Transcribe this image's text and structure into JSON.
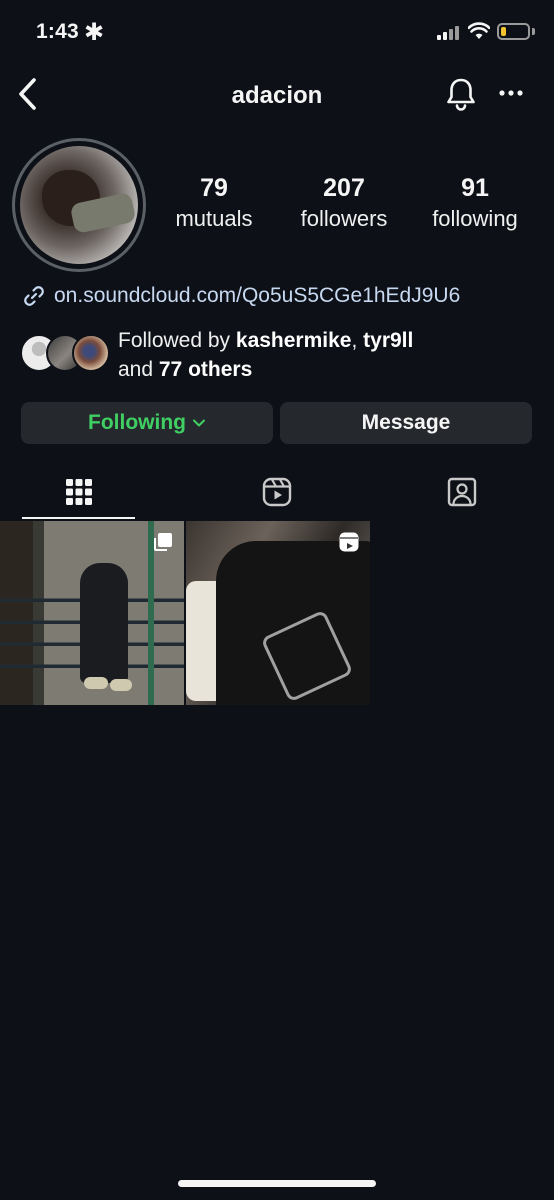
{
  "status_bar": {
    "time": "1:43",
    "asterisk": "✱",
    "battery_level": 0.2,
    "battery_color": "#f4c430"
  },
  "header": {
    "username": "adacion",
    "back_icon": "chevron-left-icon",
    "bell_icon": "bell-icon",
    "more_icon": "more-horizontal-icon"
  },
  "profile": {
    "stats": [
      {
        "value": "79",
        "label": "mutuals"
      },
      {
        "value": "207",
        "label": "followers"
      },
      {
        "value": "91",
        "label": "following"
      }
    ],
    "link": "on.soundcloud.com/Qo5uS5CGe1hEdJ9U6",
    "followed_by": {
      "prefix": "Followed by ",
      "user1": "kashermike",
      "sep": ", ",
      "user2": "tyr9ll",
      "line2_prefix": "and ",
      "others": "77 others"
    }
  },
  "actions": {
    "following_label": "Following",
    "message_label": "Message",
    "following_color": "#3fcf63"
  },
  "tabs": [
    {
      "name": "grid",
      "icon": "grid-icon",
      "active": true
    },
    {
      "name": "reels",
      "icon": "reels-icon",
      "active": false
    },
    {
      "name": "tagged",
      "icon": "tagged-person-icon",
      "active": false
    }
  ],
  "posts": [
    {
      "badge_icon": "carousel-icon"
    },
    {
      "badge_icon": "reel-icon"
    }
  ]
}
